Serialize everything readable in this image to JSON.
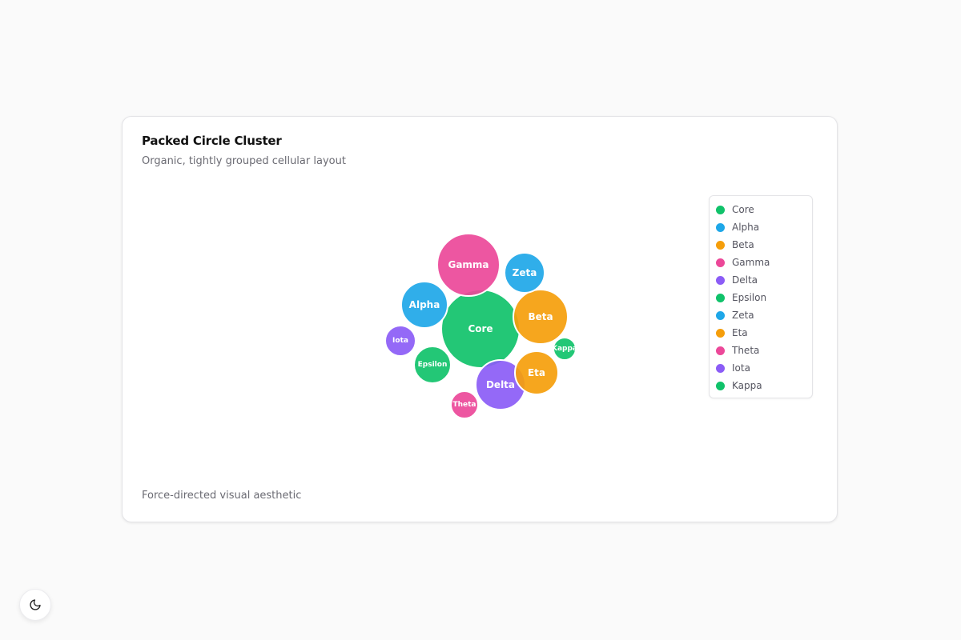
{
  "card": {
    "title": "Packed Circle Cluster",
    "subtitle": "Organic, tightly grouped cellular layout",
    "footer": "Force-directed visual aesthetic"
  },
  "chart_data": {
    "type": "bubble",
    "title": "Packed Circle Cluster",
    "subtitle": "Organic, tightly grouped cellular layout",
    "legend_position": "right",
    "grid": false,
    "nodes": [
      {
        "name": "Core",
        "color": "#10c26a"
      },
      {
        "name": "Alpha",
        "color": "#1ea7e8"
      },
      {
        "name": "Beta",
        "color": "#f59e0b"
      },
      {
        "name": "Gamma",
        "color": "#ec4899"
      },
      {
        "name": "Delta",
        "color": "#8b5cf6"
      },
      {
        "name": "Epsilon",
        "color": "#10c26a"
      },
      {
        "name": "Zeta",
        "color": "#1ea7e8"
      },
      {
        "name": "Eta",
        "color": "#f59e0b"
      },
      {
        "name": "Theta",
        "color": "#ec4899"
      },
      {
        "name": "Iota",
        "color": "#8b5cf6"
      },
      {
        "name": "Kappa",
        "color": "#10c26a"
      }
    ]
  },
  "legend": {
    "items": [
      {
        "label": "Core",
        "color": "#10c26a"
      },
      {
        "label": "Alpha",
        "color": "#1ea7e8"
      },
      {
        "label": "Beta",
        "color": "#f59e0b"
      },
      {
        "label": "Gamma",
        "color": "#ec4899"
      },
      {
        "label": "Delta",
        "color": "#8b5cf6"
      },
      {
        "label": "Epsilon",
        "color": "#10c26a"
      },
      {
        "label": "Zeta",
        "color": "#1ea7e8"
      },
      {
        "label": "Eta",
        "color": "#f59e0b"
      },
      {
        "label": "Theta",
        "color": "#ec4899"
      },
      {
        "label": "Iota",
        "color": "#8b5cf6"
      },
      {
        "label": "Kappa",
        "color": "#10c26a"
      }
    ]
  },
  "theme_toggle": {
    "icon": "moon-icon"
  }
}
